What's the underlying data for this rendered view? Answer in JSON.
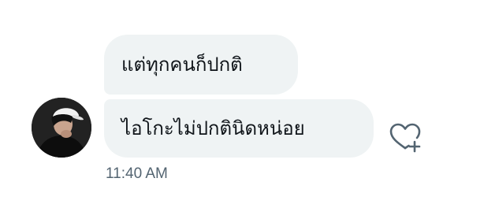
{
  "messages": [
    {
      "text": "แต่ทุกคนก็ปกติ"
    },
    {
      "text": "ไอโกะไม่ปกตินิดหน่อย"
    }
  ],
  "sender": {
    "avatar_icon": "user-avatar-photo"
  },
  "reaction": {
    "icon": "heart-plus-icon"
  },
  "timestamp": "11:40 AM",
  "colors": {
    "bubble_bg": "#eff3f4",
    "text": "#0f1419",
    "timestamp": "#536471",
    "icon": "#536471"
  }
}
